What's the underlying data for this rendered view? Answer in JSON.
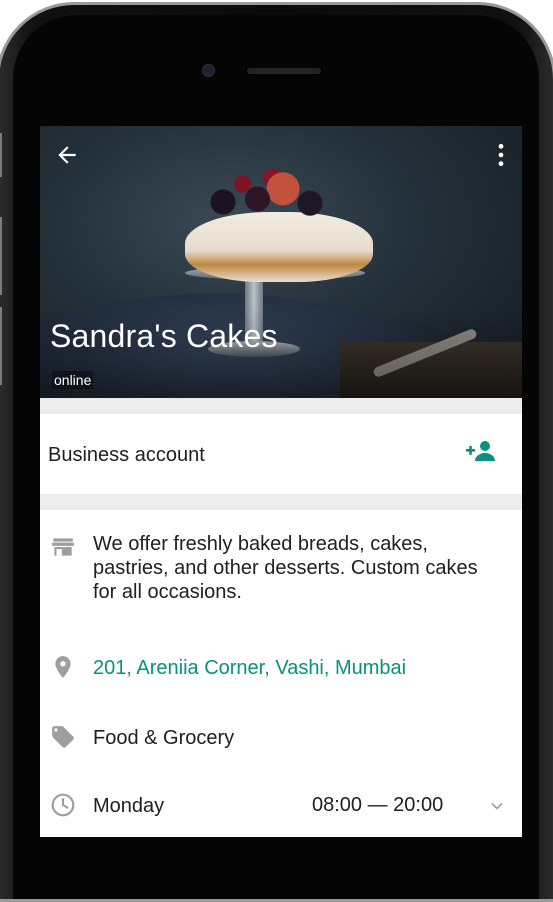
{
  "header": {
    "title": "Sandra's Cakes",
    "status": "online"
  },
  "account": {
    "label": "Business account"
  },
  "info": {
    "description": "We offer freshly baked breads, cakes, pastries, and other desserts. Custom cakes for all occasions.",
    "address": "201, Areniia Corner, Vashi, Mumbai",
    "category": "Food & Grocery",
    "hours": {
      "day": "Monday",
      "time": "08:00 — 20:00"
    }
  },
  "colors": {
    "accent": "#07927f",
    "icon_gray": "#9e9e9e",
    "divider": "#ececec"
  },
  "icons": [
    "back-arrow-icon",
    "more-vert-icon",
    "add-contact-icon",
    "store-icon",
    "location-pin-icon",
    "tag-icon",
    "clock-icon",
    "chevron-down-icon"
  ]
}
